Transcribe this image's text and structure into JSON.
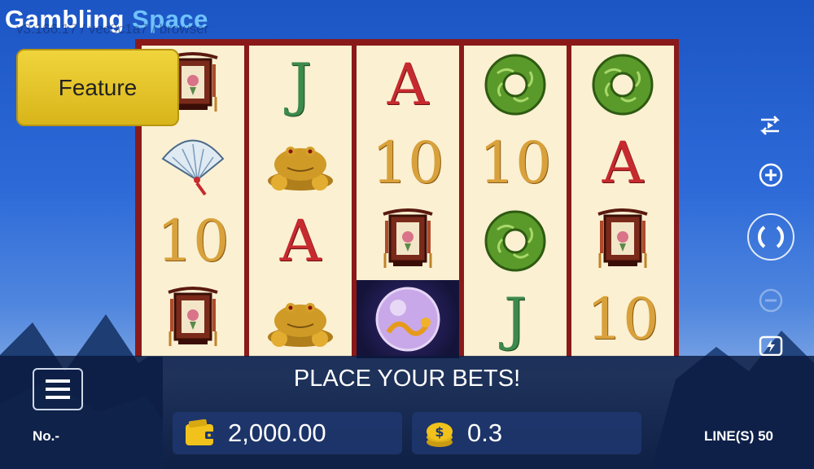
{
  "brand": {
    "word1": "Gambling",
    "word2": "Space"
  },
  "version": "v3.166.17 / vec0c1a7 / browser",
  "feature_button": {
    "label": "Feature"
  },
  "reels": [
    [
      "lantern",
      "fan",
      "10",
      "lantern"
    ],
    [
      "J",
      "toad",
      "A",
      "toad"
    ],
    [
      "A",
      "10",
      "lantern",
      "pearl"
    ],
    [
      "jade",
      "10",
      "jade",
      "J"
    ],
    [
      "jade",
      "A",
      "lantern",
      "10"
    ]
  ],
  "right_controls": [
    "autoplay-icon",
    "bet-plus-icon",
    "spin-icon",
    "bet-minus-icon",
    "turbo-icon"
  ],
  "status": {
    "message": "PLACE YOUR BETS!"
  },
  "footer": {
    "game_number": "No.-",
    "balance": "2,000.00",
    "bet": "0.3",
    "lines": "LINE(S) 50"
  },
  "colors": {
    "reel_frame": "#8a1a1a",
    "reel_bg": "#fbf0d2",
    "feature_bg": "#e8c82a",
    "panel_bg": "#0a193c"
  }
}
